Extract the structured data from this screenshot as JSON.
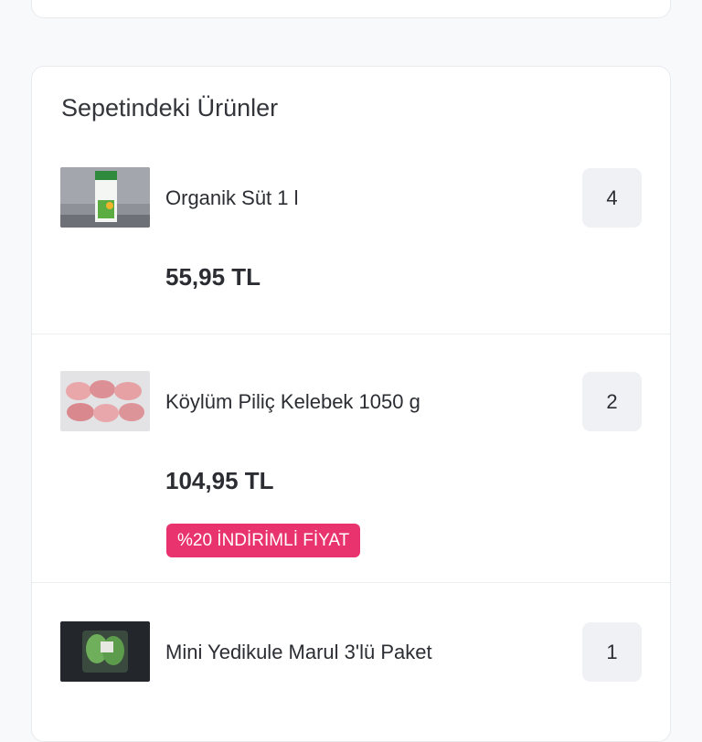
{
  "cart": {
    "title": "Sepetindeki Ürünler",
    "items": [
      {
        "name": "Organik Süt 1 l",
        "quantity": "4",
        "price": "55,95 TL",
        "badge": "",
        "image": "milk-carton-image"
      },
      {
        "name": "Köylüm Piliç Kelebek 1050 g",
        "quantity": "2",
        "price": "104,95 TL",
        "badge": "%20 İNDİRİMLİ FİYAT",
        "image": "chicken-meat-image"
      },
      {
        "name": "Mini Yedikule Marul 3'lü Paket",
        "quantity": "1",
        "price": "",
        "badge": "",
        "image": "lettuce-pack-image"
      }
    ]
  },
  "colors": {
    "badge": "#e8336f",
    "quantity_bg": "#f0f1f4",
    "card_border": "#e9eaee"
  }
}
